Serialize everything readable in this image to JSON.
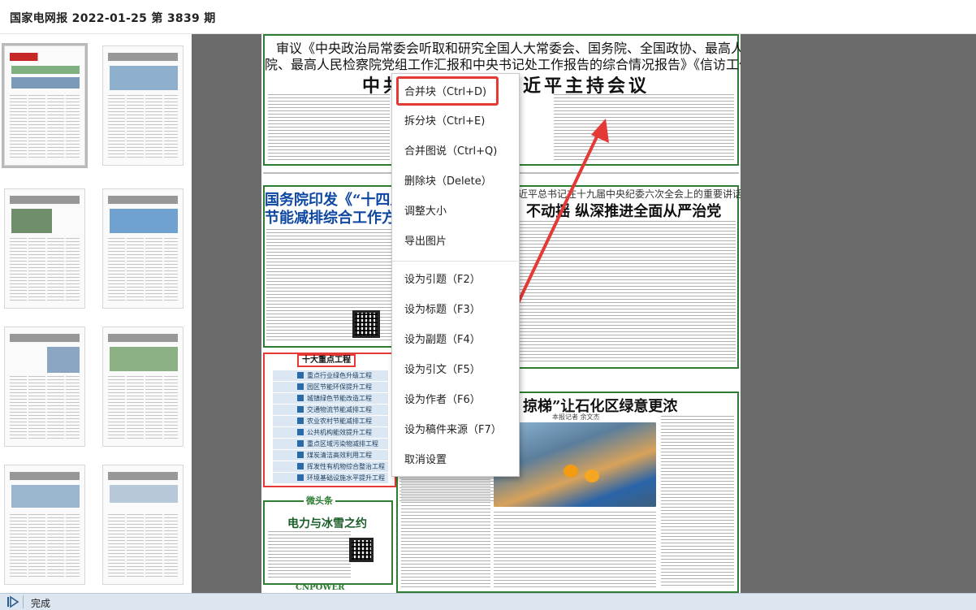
{
  "window": {
    "title": "国家电网报 2022-01-25 第 3839 期"
  },
  "page": {
    "top_headline_line1": "审议《中央政治局常委会听取和研究全国人大常委会、国务院、全国政协、最高人民法",
    "top_headline_line2": "院、最高人民检察院党组工作汇报和中央书记处工作报告的综合情况报告》《信访工作条例》",
    "top_headline_left": "中共",
    "top_headline_right": "近平主持会议",
    "left_article_title_line1": "国务院印发《“十四五”",
    "left_article_title_line2": "节能减排综合工作方案》",
    "right_article_kicker": "习近平总书记在十九届中央纪委六次全会上的重要讲话精神",
    "right_article_title": "不动摇  纵深推进全面从严治党",
    "feature_title": "掠梯”让石化区绿意更浓",
    "feature_byline": "本报记者  余文杰",
    "side_label": "微头条",
    "side_title": "电力与冰雪之约",
    "footer_logo": "CNPOWER",
    "list_title": "十大重点工程",
    "list_items": [
      "重点行业绿色升级工程",
      "园区节能环保提升工程",
      "城镇绿色节能改造工程",
      "交通物流节能减排工程",
      "农业农村节能减排工程",
      "公共机构能效提升工程",
      "重点区域污染物减排工程",
      "煤炭清洁高效利用工程",
      "挥发性有机物综合整治工程",
      "环境基础设施水平提升工程"
    ]
  },
  "context_menu": {
    "items": [
      {
        "label": "合并块（Ctrl+D)"
      },
      {
        "label": "拆分块（Ctrl+E)"
      },
      {
        "label": "合并图说（Ctrl+Q)"
      },
      {
        "label": "删除块（Delete）"
      },
      {
        "label": "调整大小"
      },
      {
        "label": "导出图片"
      },
      {
        "label": "设为引题（F2）"
      },
      {
        "label": "设为标题（F3）"
      },
      {
        "label": "设为副题（F4）"
      },
      {
        "label": "设为引文（F5）"
      },
      {
        "label": "设为作者（F6）"
      },
      {
        "label": "设为稿件来源（F7）"
      },
      {
        "label": "取消设置"
      }
    ]
  },
  "status": {
    "text": "完成"
  },
  "colors": {
    "highlight_red": "#e53935",
    "block_green": "#2e7d32",
    "viewer_gray": "#6b6b6b",
    "status_blue": "#dce6f0"
  }
}
